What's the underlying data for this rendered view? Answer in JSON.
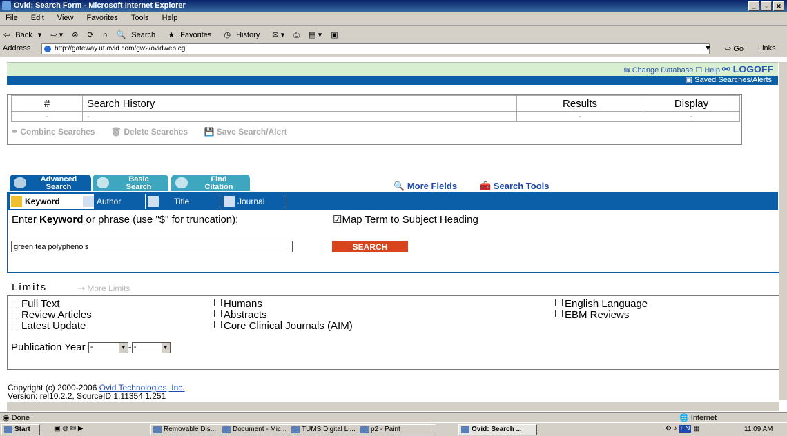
{
  "window": {
    "title": "Ovid: Search Form - Microsoft Internet Explorer"
  },
  "menu": [
    "File",
    "Edit",
    "View",
    "Favorites",
    "Tools",
    "Help"
  ],
  "toolbar": {
    "back": "Back",
    "search": "Search",
    "favorites": "Favorites",
    "history": "History"
  },
  "address": {
    "label": "Address",
    "url": "http://gateway.ut.ovid.com/gw2/ovidweb.cgi",
    "go": "Go",
    "links": "Links"
  },
  "header": {
    "change_db": "Change Database",
    "help": "Help",
    "logoff": "LOGOFF",
    "saved": "Saved Searches/Alerts"
  },
  "history": {
    "col_num": "#",
    "col_history": "Search History",
    "col_results": "Results",
    "col_display": "Display",
    "row": [
      "-",
      "-",
      "-",
      "-"
    ],
    "combine": "Combine Searches",
    "delete": "Delete Searches",
    "save": "Save Search/Alert"
  },
  "tabs": {
    "advanced_1": "Advanced",
    "advanced_2": "Search",
    "basic_1": "Basic",
    "basic_2": "Search",
    "find_1": "Find",
    "find_2": "Citation"
  },
  "tools": {
    "more_fields": "More Fields",
    "search_tools": "Search Tools"
  },
  "field_tabs": {
    "keyword": "Keyword",
    "author": "Author",
    "title": "Title",
    "journal": "Journal"
  },
  "search": {
    "prompt_pre": "Enter ",
    "prompt_kw": "Keyword",
    "prompt_post": " or phrase (use \"$\" for truncation):",
    "value": "green tea polyphenols",
    "map_label": "Map Term to Subject Heading",
    "button": "SEARCH"
  },
  "limits": {
    "title": "Limits",
    "more": "More Limits",
    "full_text": "Full Text",
    "review": "Review Articles",
    "latest": "Latest Update",
    "humans": "Humans",
    "abstracts": "Abstracts",
    "core": "Core Clinical Journals (AIM)",
    "english": "English Language",
    "ebm": "EBM Reviews",
    "pub_year": "Publication Year",
    "year_from": "-",
    "year_to": "-"
  },
  "footer": {
    "copyright": "Copyright (c) 2000-2006 ",
    "company": "Ovid Technologies, Inc.",
    "version": "Version: rel10.2.2, SourceID 1.11354.1.251"
  },
  "status": {
    "left": "Done",
    "zone": "Internet"
  },
  "taskbar": {
    "start": "Start",
    "items": [
      "Removable Dis...",
      "Document - Mic...",
      "TUMS Digital Li...",
      "p2 - Paint",
      "Ovid: Search ..."
    ],
    "lang": "EN",
    "clock": "11:09 AM"
  }
}
